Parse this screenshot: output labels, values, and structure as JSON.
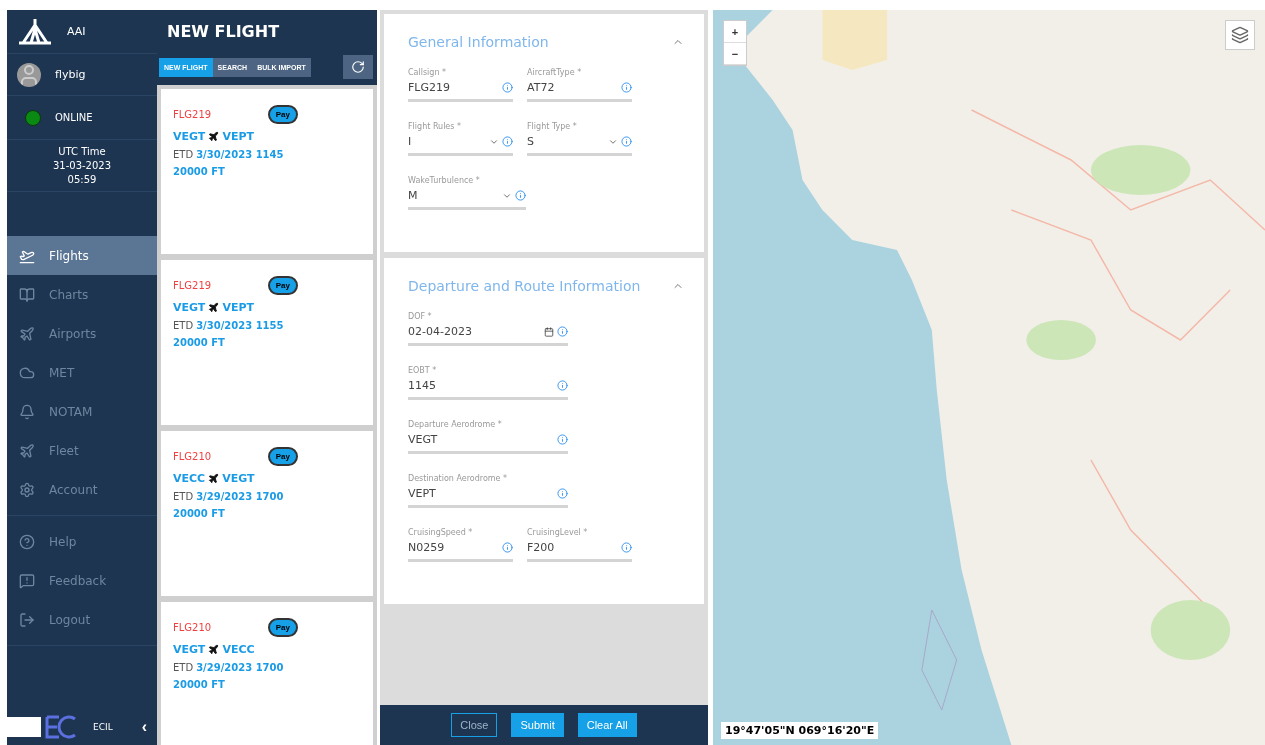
{
  "sidebar": {
    "brand": "AAI",
    "user": "flybig",
    "status": {
      "label": "ONLINE",
      "online": true
    },
    "utc": {
      "label": "UTC Time",
      "date": "31-03-2023",
      "time": "05:59"
    },
    "nav_groups": [
      [
        {
          "label": "Flights",
          "selected": true
        },
        {
          "label": "Charts",
          "selected": false
        },
        {
          "label": "Airports",
          "selected": false
        },
        {
          "label": "MET",
          "selected": false
        },
        {
          "label": "NOTAM",
          "selected": false
        },
        {
          "label": "Fleet",
          "selected": false
        },
        {
          "label": "Account",
          "selected": false
        }
      ],
      [
        {
          "label": "Help",
          "selected": false
        },
        {
          "label": "Feedback",
          "selected": false
        },
        {
          "label": "Logout",
          "selected": false
        }
      ]
    ],
    "footer": {
      "company": "ECIL",
      "collapse": "‹"
    }
  },
  "flights_panel": {
    "title": "NEW FLIGHT",
    "tabs": [
      {
        "label": "NEW FLIGHT",
        "selected": true
      },
      {
        "label": "SEARCH",
        "selected": false
      },
      {
        "label": "BULK IMPORT",
        "selected": false
      }
    ],
    "cards": [
      {
        "callsign": "FLG219",
        "pay": "Pay",
        "from": "VEGT",
        "to": "VEPT",
        "etd_label": "ETD",
        "etd": "3/30/2023 1145",
        "level": "20000 FT"
      },
      {
        "callsign": "FLG219",
        "pay": "Pay",
        "from": "VEGT",
        "to": "VEPT",
        "etd_label": "ETD",
        "etd": "3/30/2023 1155",
        "level": "20000 FT"
      },
      {
        "callsign": "FLG210",
        "pay": "Pay",
        "from": "VECC",
        "to": "VEGT",
        "etd_label": "ETD",
        "etd": "3/29/2023 1700",
        "level": "20000 FT"
      },
      {
        "callsign": "FLG210",
        "pay": "Pay",
        "from": "VEGT",
        "to": "VECC",
        "etd_label": "ETD",
        "etd": "3/29/2023 1700",
        "level": "20000 FT"
      }
    ]
  },
  "form": {
    "sections": [
      {
        "title": "General Information",
        "expanded": true,
        "rows": [
          [
            {
              "label": "Callsign *",
              "value": "FLG219",
              "kind": "text"
            },
            {
              "label": "AircraftType *",
              "value": "AT72",
              "kind": "text"
            }
          ],
          [
            {
              "label": "Flight Rules *",
              "value": "I",
              "kind": "select"
            },
            {
              "label": "Flight Type *",
              "value": "S",
              "kind": "select"
            }
          ],
          [
            {
              "label": "WakeTurbulence *",
              "value": "M",
              "kind": "select"
            }
          ]
        ]
      },
      {
        "title": "Departure and Route Information",
        "expanded": true,
        "rows": [
          [
            {
              "label": "DOF *",
              "value": "02-04-2023",
              "kind": "date"
            }
          ],
          [
            {
              "label": "EOBT *",
              "value": "1145",
              "kind": "text"
            }
          ],
          [
            {
              "label": "Departure Aerodrome *",
              "value": "VEGT",
              "kind": "text"
            }
          ],
          [
            {
              "label": "Destination Aerodrome *",
              "value": "VEPT",
              "kind": "text"
            }
          ],
          [
            {
              "label": "CruisingSpeed *",
              "value": "N0259",
              "kind": "text"
            },
            {
              "label": "CruisingLevel *",
              "value": "F200",
              "kind": "text"
            }
          ]
        ]
      }
    ],
    "buttons": [
      {
        "label": "Close",
        "kind": "outline"
      },
      {
        "label": "Submit",
        "kind": "primary"
      },
      {
        "label": "Clear All",
        "kind": "primary"
      }
    ]
  },
  "map": {
    "zoom_in": "+",
    "zoom_out": "−",
    "coordinates": "19°47'05\"N 069°16'20\"E"
  }
}
